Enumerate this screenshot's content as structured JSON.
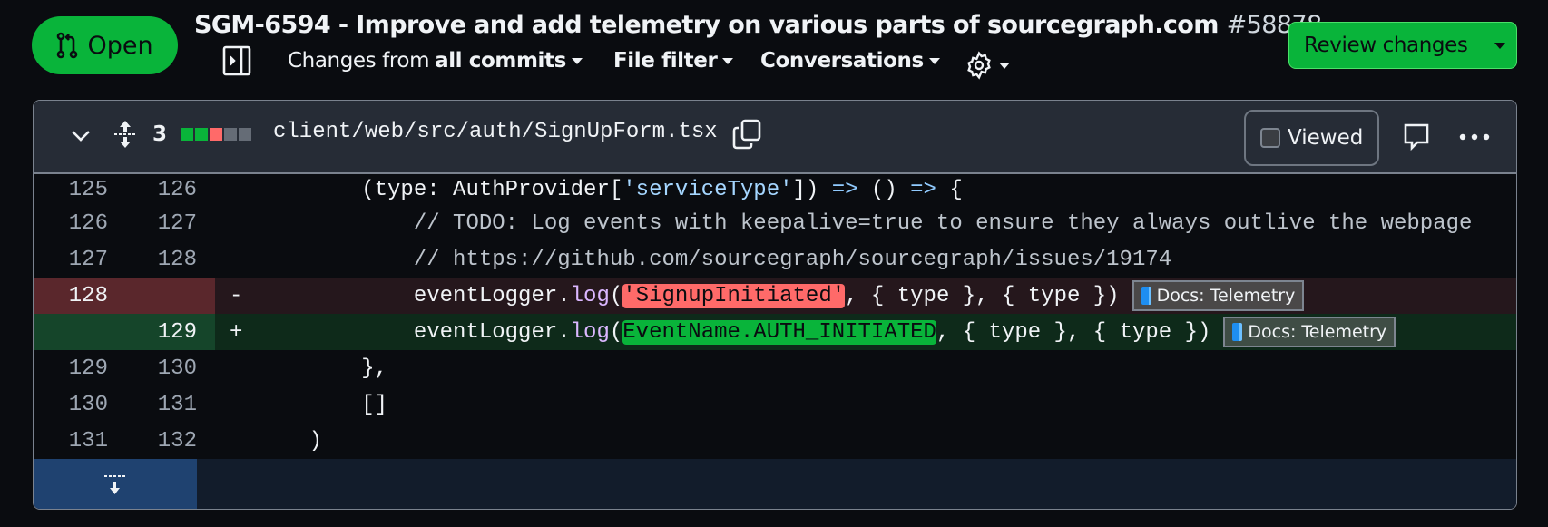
{
  "header": {
    "status": "Open",
    "title": "SGM-6594 - Improve and add telemetry on various parts of sourcegraph.com",
    "number": "#58878",
    "changes_prefix": "Changes from",
    "changes_value": "all commits",
    "file_filter": "File filter",
    "conversations": "Conversations",
    "review_button": "Review changes"
  },
  "file": {
    "changed_count": "3",
    "diffstat": [
      "added",
      "added",
      "deleted",
      "neutral",
      "neutral"
    ],
    "path": "client/web/src/auth/SignUpForm.tsx",
    "viewed_label": "Viewed",
    "viewed": false
  },
  "colors": {
    "added": "#09b43a",
    "deleted": "#ff6a69",
    "neutral": "#656c76"
  },
  "lines": [
    {
      "old": "125",
      "new": "126",
      "type": "ctx",
      "marker": "",
      "tokens": [
        {
          "t": "        (type: AuthProvider["
        },
        {
          "t": "'serviceType'",
          "k": "str"
        },
        {
          "t": "]) "
        },
        {
          "t": "=>",
          "k": "op"
        },
        {
          "t": " () "
        },
        {
          "t": "=>",
          "k": "op"
        },
        {
          "t": " {"
        }
      ]
    },
    {
      "old": "126",
      "new": "127",
      "type": "ctx",
      "marker": "",
      "tokens": [
        {
          "t": "            // TODO: Log events with keepalive=true to ensure they always outlive the webpage",
          "k": "cmt"
        }
      ]
    },
    {
      "old": "127",
      "new": "128",
      "type": "ctx",
      "marker": "",
      "tokens": [
        {
          "t": "            // https://github.com/sourcegraph/sourcegraph/issues/19174",
          "k": "cmt"
        }
      ]
    },
    {
      "old": "128",
      "new": "",
      "type": "del",
      "marker": "-",
      "tokens": [
        {
          "t": "            eventLogger."
        },
        {
          "t": "log",
          "k": "fn"
        },
        {
          "t": "("
        },
        {
          "t": "'SignupInitiated'",
          "k": "del"
        },
        {
          "t": ", { type }, { type })"
        }
      ],
      "badge": "Docs: Telemetry"
    },
    {
      "old": "",
      "new": "129",
      "type": "add",
      "marker": "+",
      "tokens": [
        {
          "t": "            eventLogger."
        },
        {
          "t": "log",
          "k": "fn"
        },
        {
          "t": "("
        },
        {
          "t": "EventName.AUTH_INITIATED",
          "k": "add"
        },
        {
          "t": ", { type }, { type })"
        }
      ],
      "badge": "Docs: Telemetry"
    },
    {
      "old": "129",
      "new": "130",
      "type": "ctx",
      "marker": "",
      "tokens": [
        {
          "t": "        },"
        }
      ]
    },
    {
      "old": "130",
      "new": "131",
      "type": "ctx",
      "marker": "",
      "tokens": [
        {
          "t": "        []"
        }
      ]
    },
    {
      "old": "131",
      "new": "132",
      "type": "ctx",
      "marker": "",
      "tokens": [
        {
          "t": "    )"
        }
      ]
    }
  ]
}
